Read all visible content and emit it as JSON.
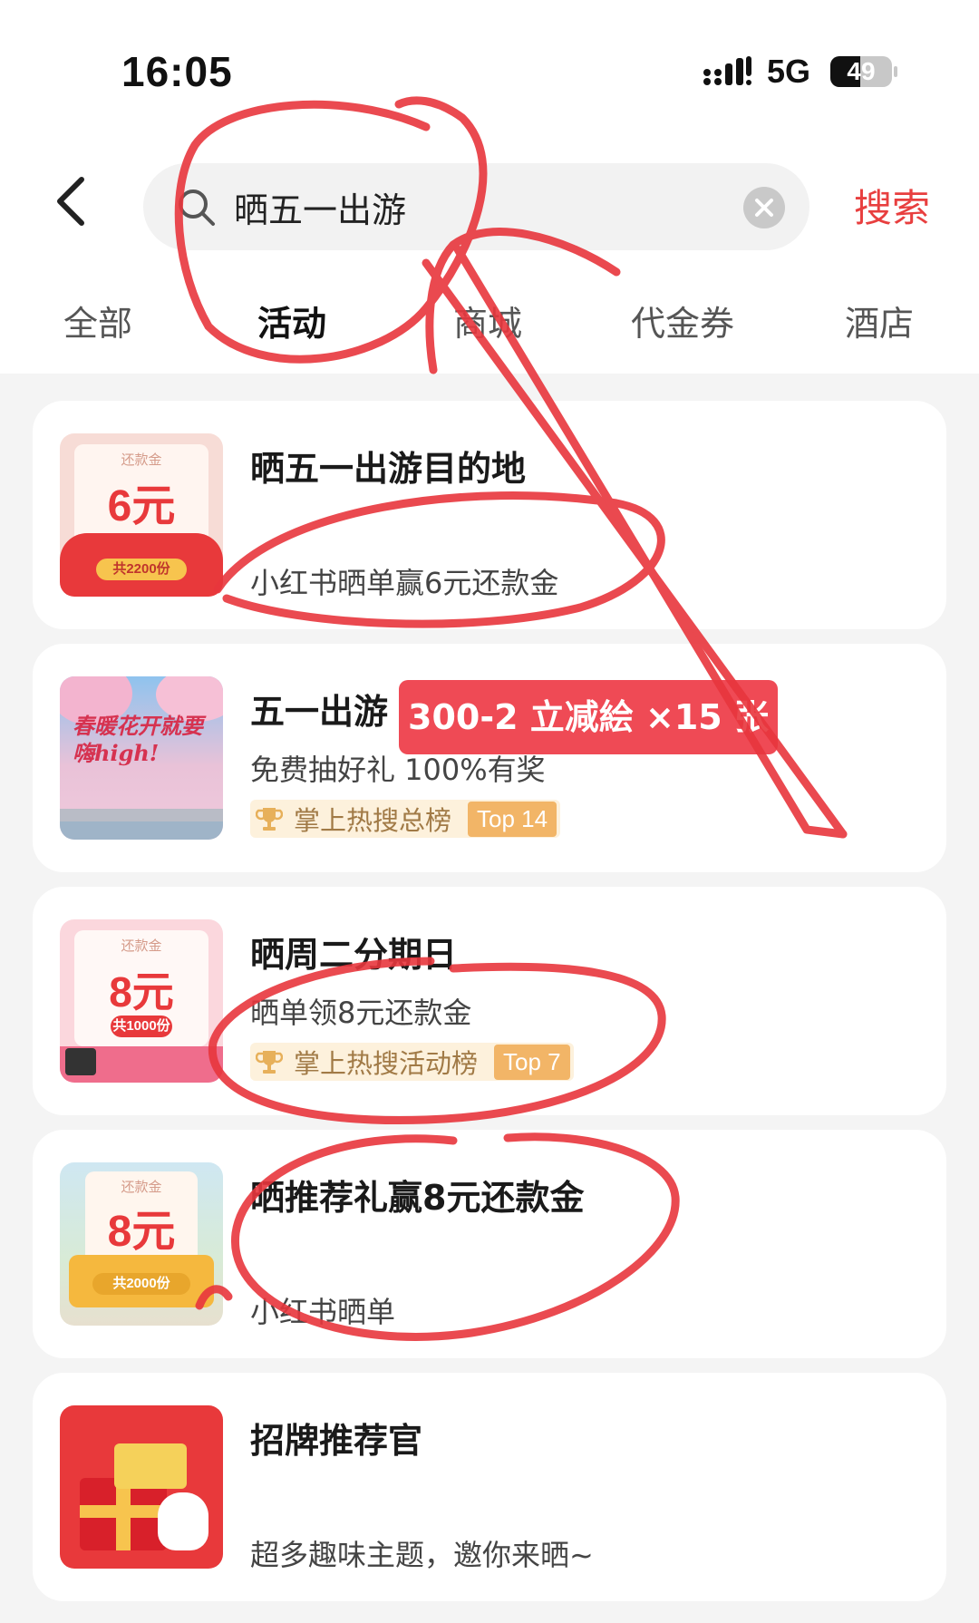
{
  "status_bar": {
    "time": "16:05",
    "network": "5G",
    "battery": "49",
    "battery_level": 0.49
  },
  "search": {
    "query": "晒五一出游",
    "submit_label": "搜索"
  },
  "tabs": [
    {
      "label": "全部",
      "active": false
    },
    {
      "label": "活动",
      "active": true
    },
    {
      "label": "商城",
      "active": false
    },
    {
      "label": "代金券",
      "active": false
    },
    {
      "label": "酒店",
      "active": false
    }
  ],
  "results": [
    {
      "title": "晒五一出游目的地",
      "subtitle": "小红书晒单赢6元还款金",
      "thumb": {
        "label": "还款金",
        "amount": "6元",
        "count": "共2200份"
      }
    },
    {
      "title": "五一出游",
      "subtitle": "免费抽好礼 100%有奖",
      "rank": {
        "text": "掌上热搜总榜",
        "top": "Top 14"
      },
      "thumb": {
        "text": "春暖花开就要嗨high!"
      }
    },
    {
      "title": "晒周二分期日",
      "subtitle": "晒单领8元还款金",
      "rank": {
        "text": "掌上热搜活动榜",
        "top": "Top 7"
      },
      "thumb": {
        "label": "还款金",
        "amount": "8元",
        "count": "共1000份"
      }
    },
    {
      "title": "晒推荐礼赢8元还款金",
      "subtitle": "小红书晒单",
      "thumb": {
        "label": "还款金",
        "amount": "8元",
        "count": "共2000份"
      }
    },
    {
      "title": "招牌推荐官",
      "subtitle": "超多趣味主题，邀你来晒~"
    }
  ],
  "overlay": {
    "promo_tag": "300-2 立减絵 ×15 张"
  },
  "colors": {
    "accent": "#e83f3f",
    "marker": "#e8363d",
    "rank_badge": "#fdf1dc"
  }
}
